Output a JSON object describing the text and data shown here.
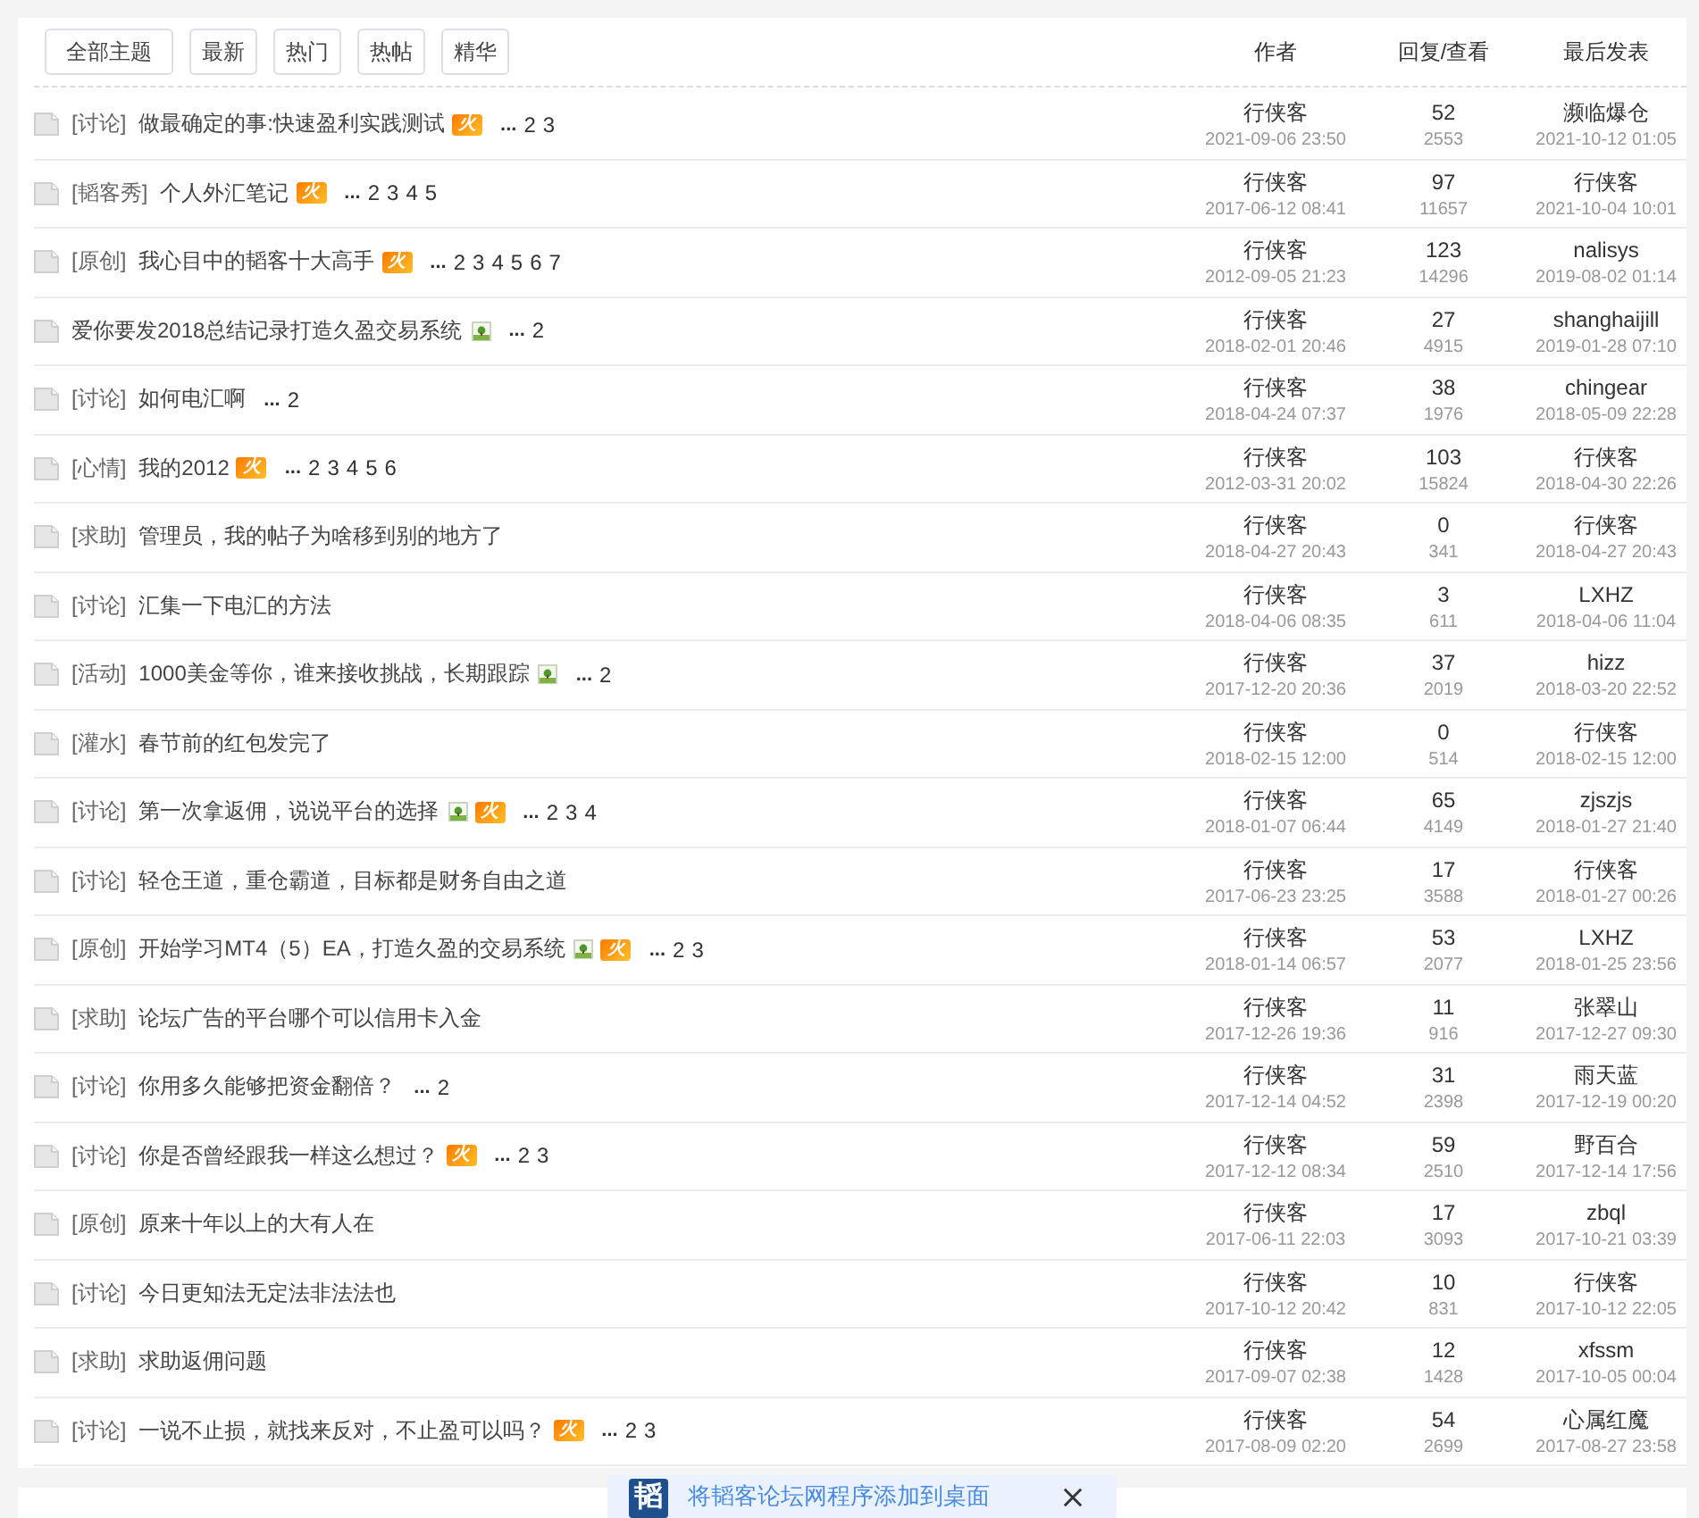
{
  "tabs": [
    {
      "label": "全部主题"
    },
    {
      "label": "最新"
    },
    {
      "label": "热门"
    },
    {
      "label": "热帖"
    },
    {
      "label": "精华"
    }
  ],
  "columns": [
    "作者",
    "回复/查看",
    "最后发表"
  ],
  "threads": [
    {
      "category": "[讨论]",
      "title": "做最确定的事:快速盈利实践测试",
      "badges": [
        {
          "kind": "hot",
          "label": "火"
        }
      ],
      "ellipsis": "...",
      "pages": [
        "2",
        "3"
      ],
      "author": "行侠客",
      "posted": "2021-09-06 23:50",
      "replies": "52",
      "views": "2553",
      "last_poster": "濒临爆仓",
      "last_time": "2021-10-12 01:05"
    },
    {
      "category": "[韬客秀]",
      "title": "个人外汇笔记",
      "badges": [
        {
          "kind": "hot",
          "label": "火"
        }
      ],
      "ellipsis": "...",
      "pages": [
        "2",
        "3",
        "4",
        "5"
      ],
      "author": "行侠客",
      "posted": "2017-06-12 08:41",
      "replies": "97",
      "views": "11657",
      "last_poster": "行侠客",
      "last_time": "2021-10-04 10:01"
    },
    {
      "category": "[原创]",
      "title": "我心目中的韬客十大高手",
      "badges": [
        {
          "kind": "hot",
          "label": "火"
        }
      ],
      "ellipsis": "...",
      "pages": [
        "2",
        "3",
        "4",
        "5",
        "6",
        "7"
      ],
      "author": "行侠客",
      "posted": "2012-09-05 21:23",
      "replies": "123",
      "views": "14296",
      "last_poster": "nalisys",
      "last_time": "2019-08-02 01:14"
    },
    {
      "title": "爱你要发2018总结记录打造久盈交易系统",
      "badges": [
        {
          "kind": "image"
        }
      ],
      "ellipsis": "...",
      "pages": [
        "2"
      ],
      "author": "行侠客",
      "posted": "2018-02-01 20:46",
      "replies": "27",
      "views": "4915",
      "last_poster": "shanghaijill",
      "last_time": "2019-01-28 07:10"
    },
    {
      "category": "[讨论]",
      "title": "如何电汇啊",
      "ellipsis": "...",
      "pages": [
        "2"
      ],
      "author": "行侠客",
      "posted": "2018-04-24 07:37",
      "replies": "38",
      "views": "1976",
      "last_poster": "chingear",
      "last_time": "2018-05-09 22:28"
    },
    {
      "category": "[心情]",
      "title": "我的2012",
      "badges": [
        {
          "kind": "hot",
          "label": "火"
        }
      ],
      "ellipsis": "...",
      "pages": [
        "2",
        "3",
        "4",
        "5",
        "6"
      ],
      "author": "行侠客",
      "posted": "2012-03-31 20:02",
      "replies": "103",
      "views": "15824",
      "last_poster": "行侠客",
      "last_time": "2018-04-30 22:26"
    },
    {
      "category": "[求助]",
      "title": "管理员，我的帖子为啥移到别的地方了",
      "author": "行侠客",
      "posted": "2018-04-27 20:43",
      "replies": "0",
      "views": "341",
      "last_poster": "行侠客",
      "last_time": "2018-04-27 20:43"
    },
    {
      "category": "[讨论]",
      "title": "汇集一下电汇的方法",
      "author": "行侠客",
      "posted": "2018-04-06 08:35",
      "replies": "3",
      "views": "611",
      "last_poster": "LXHZ",
      "last_time": "2018-04-06 11:04"
    },
    {
      "category": "[活动]",
      "title": "1000美金等你，谁来接收挑战，长期跟踪",
      "badges": [
        {
          "kind": "image"
        }
      ],
      "ellipsis": "...",
      "pages": [
        "2"
      ],
      "author": "行侠客",
      "posted": "2017-12-20 20:36",
      "replies": "37",
      "views": "2019",
      "last_poster": "hizz",
      "last_time": "2018-03-20 22:52"
    },
    {
      "category": "[灌水]",
      "title": "春节前的红包发完了",
      "author": "行侠客",
      "posted": "2018-02-15 12:00",
      "replies": "0",
      "views": "514",
      "last_poster": "行侠客",
      "last_time": "2018-02-15 12:00"
    },
    {
      "category": "[讨论]",
      "title": "第一次拿返佣，说说平台的选择",
      "badges": [
        {
          "kind": "image"
        },
        {
          "kind": "hot",
          "label": "火"
        }
      ],
      "ellipsis": "...",
      "pages": [
        "2",
        "3",
        "4"
      ],
      "author": "行侠客",
      "posted": "2018-01-07 06:44",
      "replies": "65",
      "views": "4149",
      "last_poster": "zjszjs",
      "last_time": "2018-01-27 21:40"
    },
    {
      "category": "[讨论]",
      "title": "轻仓王道，重仓霸道，目标都是财务自由之道",
      "author": "行侠客",
      "posted": "2017-06-23 23:25",
      "replies": "17",
      "views": "3588",
      "last_poster": "行侠客",
      "last_time": "2018-01-27 00:26"
    },
    {
      "category": "[原创]",
      "title": "开始学习MT4（5）EA，打造久盈的交易系统",
      "badges": [
        {
          "kind": "image"
        },
        {
          "kind": "hot",
          "label": "火"
        }
      ],
      "ellipsis": "...",
      "pages": [
        "2",
        "3"
      ],
      "author": "行侠客",
      "posted": "2018-01-14 06:57",
      "replies": "53",
      "views": "2077",
      "last_poster": "LXHZ",
      "last_time": "2018-01-25 23:56"
    },
    {
      "category": "[求助]",
      "title": "论坛广告的平台哪个可以信用卡入金",
      "author": "行侠客",
      "posted": "2017-12-26 19:36",
      "replies": "11",
      "views": "916",
      "last_poster": "张翠山",
      "last_time": "2017-12-27 09:30"
    },
    {
      "category": "[讨论]",
      "title": "你用多久能够把资金翻倍？",
      "ellipsis": "...",
      "pages": [
        "2"
      ],
      "author": "行侠客",
      "posted": "2017-12-14 04:52",
      "replies": "31",
      "views": "2398",
      "last_poster": "雨天蓝",
      "last_time": "2017-12-19 00:20"
    },
    {
      "category": "[讨论]",
      "title": "你是否曾经跟我一样这么想过？",
      "badges": [
        {
          "kind": "hot",
          "label": "火"
        }
      ],
      "ellipsis": "...",
      "pages": [
        "2",
        "3"
      ],
      "author": "行侠客",
      "posted": "2017-12-12 08:34",
      "replies": "59",
      "views": "2510",
      "last_poster": "野百合",
      "last_time": "2017-12-14 17:56"
    },
    {
      "category": "[原创]",
      "title": "原来十年以上的大有人在",
      "author": "行侠客",
      "posted": "2017-06-11 22:03",
      "replies": "17",
      "views": "3093",
      "last_poster": "zbql",
      "last_time": "2017-10-21 03:39"
    },
    {
      "category": "[讨论]",
      "title": "今日更知法无定法非法法也",
      "author": "行侠客",
      "posted": "2017-10-12 20:42",
      "replies": "10",
      "views": "831",
      "last_poster": "行侠客",
      "last_time": "2017-10-12 22:05"
    },
    {
      "category": "[求助]",
      "title": "求助返佣问题",
      "author": "行侠客",
      "posted": "2017-09-07 02:38",
      "replies": "12",
      "views": "1428",
      "last_poster": "xfssm",
      "last_time": "2017-10-05 00:04"
    },
    {
      "category": "[讨论]",
      "title": "一说不止损，就找来反对，不止盈可以吗？",
      "badges": [
        {
          "kind": "hot",
          "label": "火"
        }
      ],
      "ellipsis": "...",
      "pages": [
        "2",
        "3"
      ],
      "author": "行侠客",
      "posted": "2017-08-09 02:20",
      "replies": "54",
      "views": "2699",
      "last_poster": "心属红魔",
      "last_time": "2017-08-27 23:58"
    }
  ],
  "banner": {
    "logo": "韬",
    "text": "将韬客论坛网程序添加到桌面"
  }
}
